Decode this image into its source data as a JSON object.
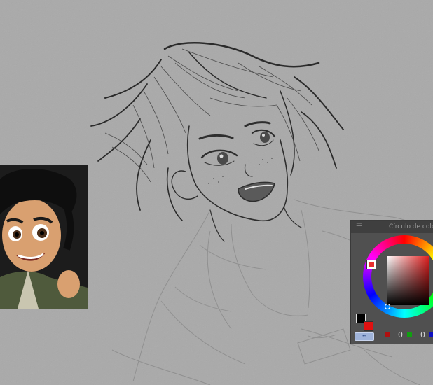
{
  "color_panel": {
    "title": "Círculo de colore",
    "menu_icon": "hamburger-icon",
    "red_value": "0",
    "green_value": "0",
    "colors": {
      "main": "#000000",
      "sub": "#e01010",
      "red_channel": "#b01010",
      "green_channel": "#10a010",
      "blue_channel": "#1010c0"
    }
  }
}
